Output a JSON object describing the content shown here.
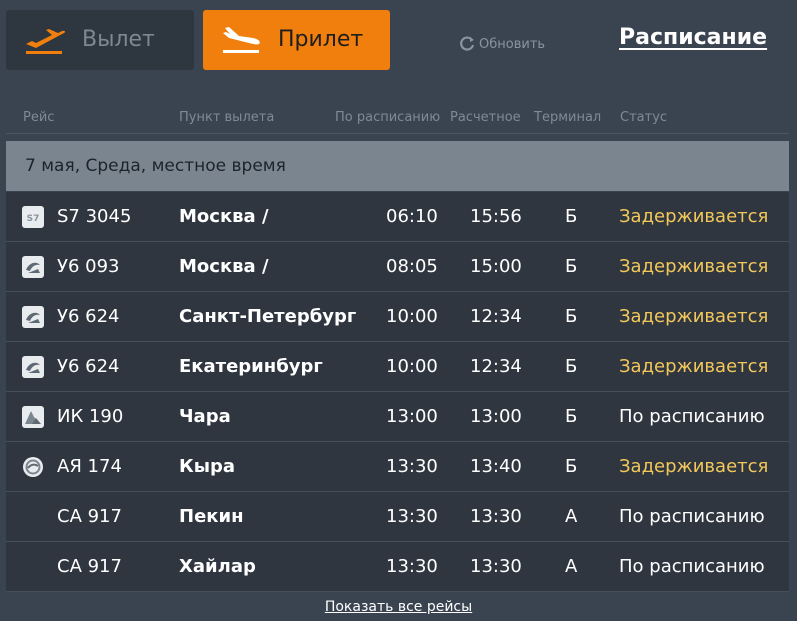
{
  "tabs": {
    "departure_label": "Вылет",
    "arrival_label": "Прилет"
  },
  "refresh_label": "Обновить",
  "schedule_link": "Расписание",
  "headers": {
    "flight": "Рейс",
    "origin": "Пункт вылета",
    "scheduled": "По расписанию",
    "estimated": "Расчетное",
    "terminal": "Терминал",
    "status": "Статус"
  },
  "date_bar": "7 мая, Среда, местное время",
  "flights": [
    {
      "logo": "s7-logo",
      "flight": "S7 3045",
      "city": "Москва /",
      "scheduled": "06:10",
      "estimated": "15:56",
      "terminal": "Б",
      "status": "Задерживается",
      "status_type": "delayed"
    },
    {
      "logo": "ural-airlines-logo",
      "flight": "У6 093",
      "city": "Москва /",
      "scheduled": "08:05",
      "estimated": "15:00",
      "terminal": "Б",
      "status": "Задерживается",
      "status_type": "delayed"
    },
    {
      "logo": "ural-airlines-logo",
      "flight": "У6 624",
      "city": "Санкт-Петербург",
      "scheduled": "10:00",
      "estimated": "12:34",
      "terminal": "Б",
      "status": "Задерживается",
      "status_type": "delayed"
    },
    {
      "logo": "ural-airlines-logo",
      "flight": "У6 624",
      "city": "Екатеринбург",
      "scheduled": "10:00",
      "estimated": "12:34",
      "terminal": "Б",
      "status": "Задерживается",
      "status_type": "delayed"
    },
    {
      "logo": "ik-airline-logo",
      "flight": "ИК 190",
      "city": "Чара",
      "scheduled": "13:00",
      "estimated": "13:00",
      "terminal": "Б",
      "status": "По расписанию",
      "status_type": "ontime"
    },
    {
      "logo": "aya-airline-logo",
      "flight": "АЯ 174",
      "city": "Кыра",
      "scheduled": "13:30",
      "estimated": "13:40",
      "terminal": "Б",
      "status": "Задерживается",
      "status_type": "delayed"
    },
    {
      "logo": "",
      "flight": "CA 917",
      "city": "Пекин",
      "scheduled": "13:30",
      "estimated": "13:30",
      "terminal": "А",
      "status": "По расписанию",
      "status_type": "ontime"
    },
    {
      "logo": "",
      "flight": "CA 917",
      "city": "Хайлар",
      "scheduled": "13:30",
      "estimated": "13:30",
      "terminal": "А",
      "status": "По расписанию",
      "status_type": "ontime"
    }
  ],
  "show_all_link": "Показать все рейсы",
  "colors": {
    "accent": "#f07f0d",
    "delayed": "#f3c85a",
    "row_bg": "#2f3640",
    "date_bar_bg": "#7b858f"
  }
}
